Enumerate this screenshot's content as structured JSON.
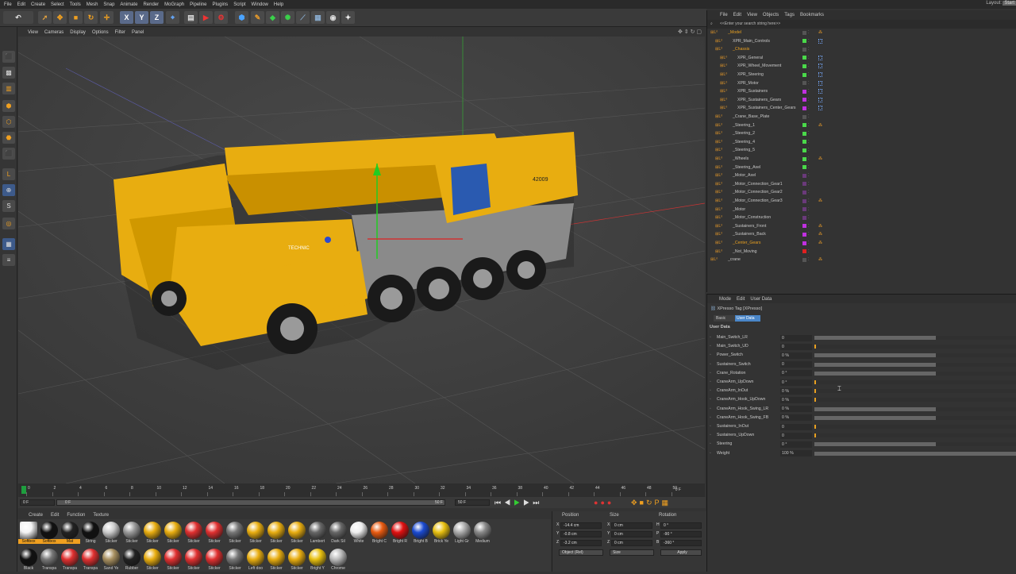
{
  "menubar": {
    "items": [
      "File",
      "Edit",
      "Create",
      "Select",
      "Tools",
      "Mesh",
      "Snap",
      "Animate",
      "Render",
      "MoGraph",
      "Pipeline",
      "Plugins",
      "Script",
      "Window",
      "Help"
    ],
    "layout_label": "Layout:",
    "layout_value": "Start"
  },
  "viewport": {
    "menu": [
      "View",
      "Cameras",
      "Display",
      "Options",
      "Filter",
      "Panel"
    ],
    "model_decal_brand": "TECHNIC",
    "model_decal_number": "42009"
  },
  "timeline": {
    "ticks": [
      "0",
      "2",
      "4",
      "6",
      "8",
      "10",
      "12",
      "14",
      "16",
      "18",
      "20",
      "22",
      "24",
      "26",
      "28",
      "30",
      "32",
      "34",
      "36",
      "38",
      "40",
      "42",
      "44",
      "46",
      "48",
      "50"
    ],
    "end_frame_label": "0 F",
    "current_frame": "0 F",
    "start_field": "0 F",
    "end_field": "50 F",
    "max_field": "50 F"
  },
  "materials": {
    "menu": [
      "Create",
      "Edit",
      "Function",
      "Texture"
    ],
    "row1": [
      "Softbox",
      "Softbox",
      "Mat",
      "String",
      "Sticker",
      "Sticker",
      "Sticker",
      "Sticker",
      "Sticker",
      "Sticker",
      "Sticker",
      "Sticker",
      "Sticker",
      "Sticker",
      "Lambert",
      "Dark Sil",
      "White",
      "Bright C",
      "Bright R",
      "Bright B",
      "Brick Ye",
      "Light Gr",
      "Medium"
    ],
    "row2": [
      "Black",
      "Transpa",
      "Transpa",
      "Transpa",
      "Sand Ye",
      "Rubber",
      "Sticker",
      "Sticker",
      "Sticker",
      "Sticker",
      "Sticker",
      "Left doo",
      "Sticker",
      "Sticker",
      "Bright Y",
      "Chrome"
    ]
  },
  "coordinates": {
    "headers": {
      "position": "Position",
      "size": "Size",
      "rotation": "Rotation"
    },
    "rows": [
      {
        "axis": "X",
        "pos": "-14.4 cm",
        "saxis": "X",
        "size": "0 cm",
        "raxis": "H",
        "rot": "0 °"
      },
      {
        "axis": "Y",
        "pos": "-0.8 cm",
        "saxis": "Y",
        "size": "0 cm",
        "raxis": "P",
        "rot": "-90 °"
      },
      {
        "axis": "Z",
        "pos": "-3.2 cm",
        "saxis": "Z",
        "size": "0 cm",
        "raxis": "B",
        "rot": "-360 °"
      }
    ],
    "mode_select": "Object (Rel)",
    "size_select": "Size",
    "apply_label": "Apply"
  },
  "object_manager": {
    "menu": [
      "File",
      "Edit",
      "View",
      "Objects",
      "Tags",
      "Bookmarks"
    ],
    "search_placeholder": "<<Enter your search string here>>",
    "objects": [
      {
        "name": "_Model",
        "indent": 0,
        "color": "#e8a020",
        "sq": "#555"
      },
      {
        "name": "XPR_Main_Controls",
        "indent": 1,
        "color": "#c8c8c8",
        "sq": "#4ad94a"
      },
      {
        "name": "_Chassis",
        "indent": 1,
        "color": "#e8a020",
        "sq": "#555"
      },
      {
        "name": "XPR_General",
        "indent": 2,
        "color": "#c8c8c8",
        "sq": "#4ad94a"
      },
      {
        "name": "XPR_Wheel_Movement",
        "indent": 2,
        "color": "#c8c8c8",
        "sq": "#4ad94a"
      },
      {
        "name": "XPR_Steering",
        "indent": 2,
        "color": "#c8c8c8",
        "sq": "#4ad94a"
      },
      {
        "name": "XPR_Motor",
        "indent": 2,
        "color": "#c8c8c8",
        "sq": "#555"
      },
      {
        "name": "XPR_Sustainers",
        "indent": 2,
        "color": "#c8c8c8",
        "sq": "#c030e0"
      },
      {
        "name": "XPR_Sustainers_Gears",
        "indent": 2,
        "color": "#c8c8c8",
        "sq": "#c030e0"
      },
      {
        "name": "XPR_Sustainers_Center_Gears",
        "indent": 2,
        "color": "#c8c8c8",
        "sq": "#c030e0"
      },
      {
        "name": "_Crane_Base_Plate",
        "indent": 1,
        "color": "#c8c8c8",
        "sq": "#555"
      },
      {
        "name": "_Steering_1",
        "indent": 1,
        "color": "#c8c8c8",
        "sq": "#4ad94a"
      },
      {
        "name": "_Steering_2",
        "indent": 1,
        "color": "#c8c8c8",
        "sq": "#4ad94a"
      },
      {
        "name": "_Steering_4",
        "indent": 1,
        "color": "#c8c8c8",
        "sq": "#4ad94a"
      },
      {
        "name": "_Steering_5",
        "indent": 1,
        "color": "#c8c8c8",
        "sq": "#4ad94a"
      },
      {
        "name": "_Wheels",
        "indent": 1,
        "color": "#c8c8c8",
        "sq": "#4ad94a"
      },
      {
        "name": "_Steering_Axel",
        "indent": 1,
        "color": "#c8c8c8",
        "sq": "#4ad94a"
      },
      {
        "name": "_Motor_Axel",
        "indent": 1,
        "color": "#c8c8c8",
        "sq": "#6a3a7a"
      },
      {
        "name": "_Motor_Connection_Gear1",
        "indent": 1,
        "color": "#c8c8c8",
        "sq": "#6a3a7a"
      },
      {
        "name": "_Motor_Connection_Gear2",
        "indent": 1,
        "color": "#c8c8c8",
        "sq": "#6a3a7a"
      },
      {
        "name": "_Motor_Connection_Gear3",
        "indent": 1,
        "color": "#c8c8c8",
        "sq": "#6a3a7a"
      },
      {
        "name": "_Motor",
        "indent": 1,
        "color": "#c8c8c8",
        "sq": "#6a3a7a"
      },
      {
        "name": "_Motor_Construction",
        "indent": 1,
        "color": "#c8c8c8",
        "sq": "#6a3a7a"
      },
      {
        "name": "_Sustainers_Front",
        "indent": 1,
        "color": "#c8c8c8",
        "sq": "#c030e0"
      },
      {
        "name": "_Sustainers_Back",
        "indent": 1,
        "color": "#c8c8c8",
        "sq": "#c030e0"
      },
      {
        "name": "_Center_Gears",
        "indent": 1,
        "color": "#e8a020",
        "sq": "#c030e0"
      },
      {
        "name": "_Not_Moving",
        "indent": 1,
        "color": "#c8c8c8",
        "sq": "#e02020"
      },
      {
        "name": "_crane",
        "indent": 0,
        "color": "#c8c8c8",
        "sq": "#555"
      }
    ]
  },
  "attributes": {
    "menu": [
      "Mode",
      "Edit",
      "User Data"
    ],
    "title": "XPresso Tag [XPresso]",
    "tabs": [
      "Basic",
      "User Data"
    ],
    "section": "User Data",
    "rows": [
      {
        "label": "Main_Switch_LR",
        "value": "0",
        "fill": 0.6
      },
      {
        "label": "Main_Switch_UD",
        "value": "0",
        "fill": 0
      },
      {
        "label": "Power_Switch",
        "value": "0 %",
        "fill": 0.6
      },
      {
        "label": "Sustainers_Switch",
        "value": "0",
        "fill": 0.6
      },
      {
        "label": "Crane_Rotation",
        "value": "0 °",
        "fill": 0.6
      },
      {
        "label": "CraneArm_UpDown",
        "value": "0 °",
        "fill": 0
      },
      {
        "label": "CraneArm_InOut",
        "value": "0 %",
        "fill": 0
      },
      {
        "label": "CraneArm_Hook_UpDown",
        "value": "0 %",
        "fill": 0
      },
      {
        "label": "CraneArm_Hook_Swing_LR",
        "value": "0 %",
        "fill": 0.6
      },
      {
        "label": "CraneArm_Hook_Swing_FB",
        "value": "0 %",
        "fill": 0.6
      },
      {
        "label": "Sustainers_InOut",
        "value": "0",
        "fill": 0
      },
      {
        "label": "Sustainers_UpDown",
        "value": "0",
        "fill": 0
      },
      {
        "label": "Steering",
        "value": "0 °",
        "fill": 0.6
      },
      {
        "label": "Weight",
        "value": "100 %",
        "fill": 1.0
      }
    ]
  },
  "colors": {
    "accent": "#4a90e2",
    "selection": "#e8a020",
    "crane_yellow": "#f0b400"
  }
}
